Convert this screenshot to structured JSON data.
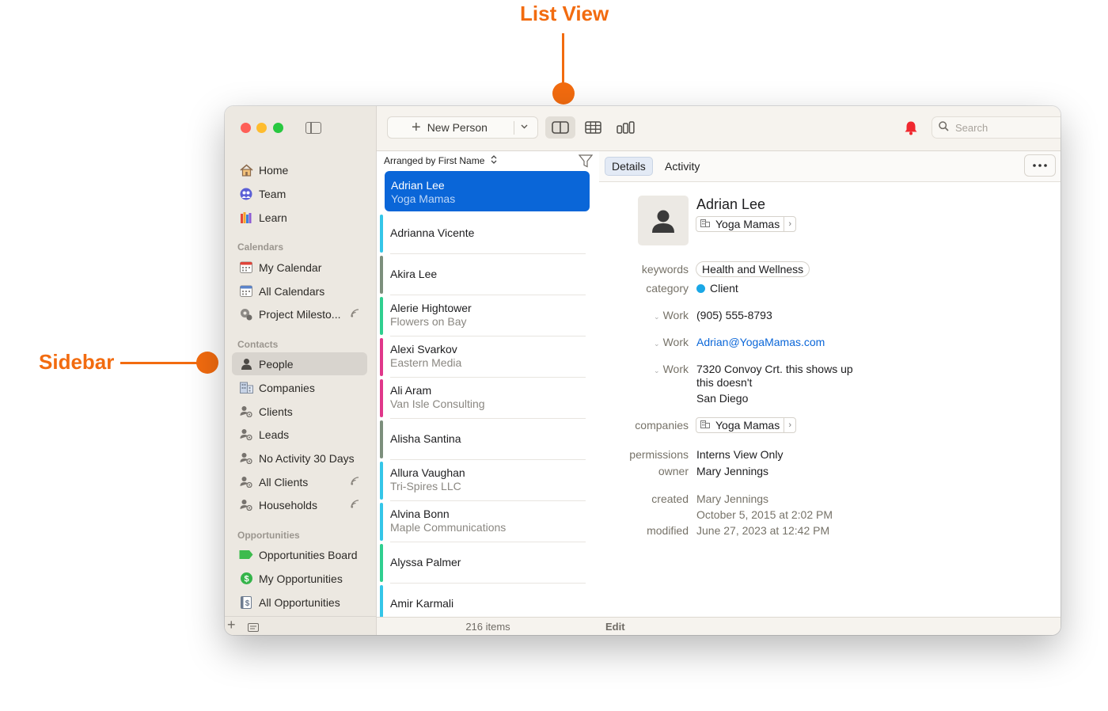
{
  "callouts": {
    "list_view": "List View",
    "sidebar": "Sidebar",
    "color": "#f26b0f"
  },
  "sidebar": {
    "items_top": [
      {
        "label": "Home",
        "icon": "house-icon"
      },
      {
        "label": "Team",
        "icon": "team-icon"
      },
      {
        "label": "Learn",
        "icon": "books-icon"
      }
    ],
    "calendars_header": "Calendars",
    "calendars": [
      {
        "label": "My Calendar",
        "icon": "calendar-icon"
      },
      {
        "label": "All Calendars",
        "icon": "calendar-icon"
      },
      {
        "label": "Project Milesto...",
        "icon": "milestone-icon",
        "synced": true
      }
    ],
    "contacts_header": "Contacts",
    "contacts": [
      {
        "label": "People",
        "icon": "person-icon",
        "selected": true
      },
      {
        "label": "Companies",
        "icon": "building-icon"
      },
      {
        "label": "Clients",
        "icon": "smart-list-icon"
      },
      {
        "label": "Leads",
        "icon": "smart-list-icon"
      },
      {
        "label": "No Activity 30 Days",
        "icon": "smart-list-icon"
      },
      {
        "label": "All Clients",
        "icon": "smart-list-icon",
        "synced": true
      },
      {
        "label": "Households",
        "icon": "smart-list-icon",
        "synced": true
      }
    ],
    "opportunities_header": "Opportunities",
    "opportunities": [
      {
        "label": "Opportunities Board",
        "icon": "tag-icon"
      },
      {
        "label": "My Opportunities",
        "icon": "dollar-icon"
      },
      {
        "label": "All Opportunities",
        "icon": "ledger-icon"
      }
    ]
  },
  "toolbar": {
    "new_person": "New Person",
    "search_placeholder": "Search"
  },
  "list": {
    "arranged_by": "Arranged by First Name",
    "count": "216 items",
    "rows": [
      {
        "name": "Adrian Lee",
        "sub": "Yoga Mamas",
        "color": "#34c6e8",
        "selected": true
      },
      {
        "name": "Adrianna Vicente",
        "sub": "",
        "color": "#34c6e8"
      },
      {
        "name": "Akira Lee",
        "sub": "",
        "color": "#7c8f7c"
      },
      {
        "name": "Alerie Hightower",
        "sub": "Flowers on Bay",
        "color": "#2fcf8f"
      },
      {
        "name": "Alexi Svarkov",
        "sub": "Eastern Media",
        "color": "#e0378a"
      },
      {
        "name": "Ali Aram",
        "sub": "Van Isle Consulting",
        "color": "#e0378a"
      },
      {
        "name": "Alisha Santina",
        "sub": "",
        "color": "#7c8f7c"
      },
      {
        "name": "Allura Vaughan",
        "sub": "Tri-Spires LLC",
        "color": "#34c6e8"
      },
      {
        "name": "Alvina Bonn",
        "sub": "Maple Communications",
        "color": "#34c6e8"
      },
      {
        "name": "Alyssa Palmer",
        "sub": "",
        "color": "#2fcf8f"
      },
      {
        "name": "Amir Karmali",
        "sub": "",
        "color": "#34c6e8"
      }
    ]
  },
  "detail": {
    "tabs": [
      "Details",
      "Activity"
    ],
    "name": "Adrian Lee",
    "company": "Yoga Mamas",
    "keywords_label": "keywords",
    "keywords": "Health and Wellness",
    "category_label": "category",
    "category": "Client",
    "category_color": "#1aa7e6",
    "phone_label": "Work",
    "phone": "(905) 555-8793",
    "email_label": "Work",
    "email": "Adrian@YogaMamas.com",
    "address_label": "Work",
    "address_line1": "7320 Convoy Crt. this shows up",
    "address_line2": "this doesn't",
    "address_line3": "San Diego",
    "companies_label": "companies",
    "companies_value": "Yoga Mamas",
    "permissions_label": "permissions",
    "permissions": "Interns View Only",
    "owner_label": "owner",
    "owner": "Mary Jennings",
    "created_label": "created",
    "created_by": "Mary Jennings",
    "created_date": "October 5, 2015 at 2:02 PM",
    "modified_label": "modified",
    "modified_date": "June 27, 2023 at 12:42 PM",
    "footer_edit": "Edit"
  }
}
